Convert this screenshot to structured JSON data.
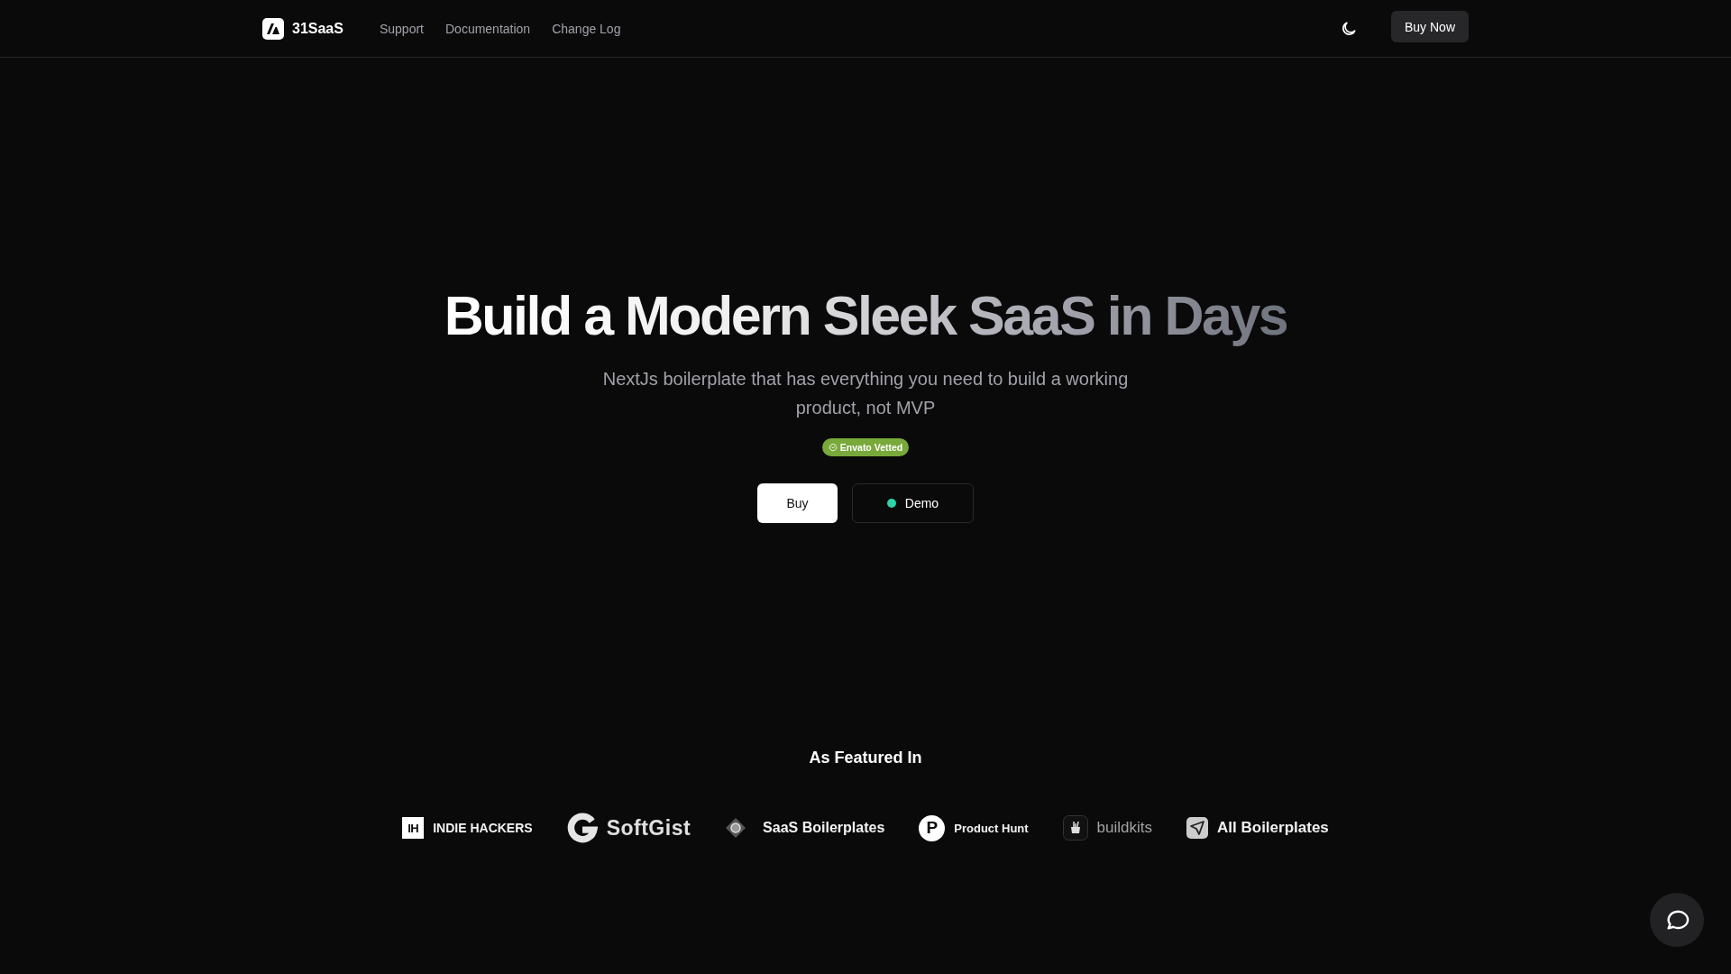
{
  "header": {
    "brand": "31SaaS",
    "nav": [
      "Support",
      "Documentation",
      "Change Log"
    ],
    "cta": "Buy Now"
  },
  "hero": {
    "title": "Build a Modern Sleek SaaS in Days",
    "subtitle": "NextJs boilerplate that has everything you need to build a working product, not MVP",
    "badge": "Envato Vetted",
    "buttons": [
      {
        "label": "Buy",
        "kind": "primary"
      },
      {
        "label": "Demo",
        "kind": "demo"
      }
    ]
  },
  "featured": {
    "title": "As Featured In",
    "logos": [
      {
        "kind": "indiehackers",
        "mark": "IH",
        "name": "INDIE HACKERS"
      },
      {
        "kind": "softgist",
        "name": "SoftGist"
      },
      {
        "kind": "saasboilerplates",
        "name": "SaaS Boilerplates"
      },
      {
        "kind": "producthunt",
        "mark": "P",
        "name": "Product Hunt"
      },
      {
        "kind": "buildkits",
        "name": "buildkits"
      },
      {
        "kind": "allboilerplates",
        "name": "All Boilerplates"
      }
    ]
  }
}
